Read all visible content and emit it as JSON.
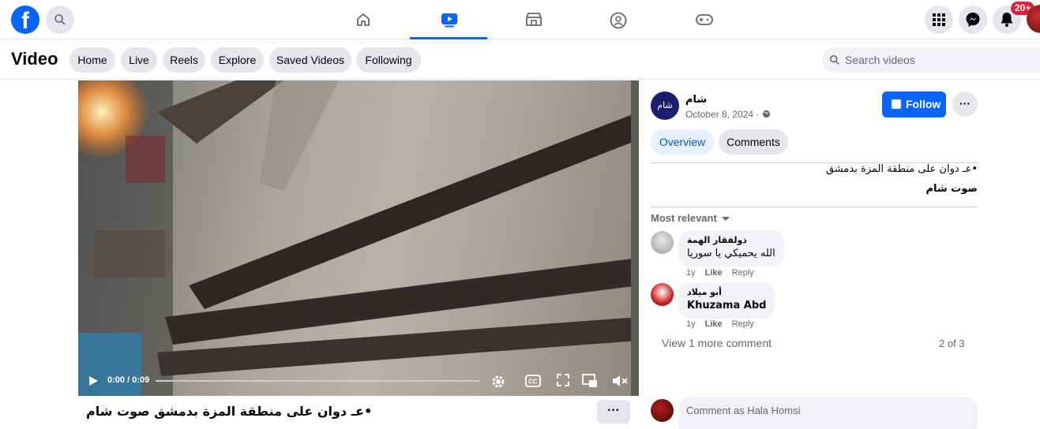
{
  "topnav": {
    "logo": "f",
    "notifications_badge": "20+",
    "tabs": [
      {
        "name": "home-icon",
        "active": false
      },
      {
        "name": "video-icon",
        "active": true
      },
      {
        "name": "marketplace-icon",
        "active": false
      },
      {
        "name": "groups-icon",
        "active": false
      },
      {
        "name": "gaming-icon",
        "active": false
      }
    ],
    "accent": "#0866ff"
  },
  "header": {
    "title": "Video",
    "pills": [
      "Home",
      "Live",
      "Reels",
      "Explore",
      "Saved Videos",
      "Following"
    ],
    "search_placeholder": "Search videos"
  },
  "video": {
    "time": "0:00 / 0:09",
    "caption": "•عـ دوان على منطقة المزة بدمشق صوت شام",
    "more_label": "···"
  },
  "post": {
    "page_name": "شام",
    "avatar_text": "شام",
    "date": "October 8, 2024 · ",
    "follow_label": "Follow",
    "more_label": "···",
    "tabs": [
      "Overview",
      "Comments"
    ],
    "description_line1": "•عـ دوان على منطقة المزة بدمشق",
    "description_line2": "صوت شام"
  },
  "comments": {
    "sort_label": "Most relevant",
    "items": [
      {
        "author": "ذولفقار الهمة",
        "text": "الله يحميكي يا سوريا",
        "age": "1y",
        "like": "Like",
        "reply": "Reply"
      },
      {
        "author": "أبو ميلاد",
        "text": "Khuzama Abd",
        "age": "1y",
        "like": "Like",
        "reply": "Reply"
      }
    ],
    "view_more": "View 1 more comment",
    "page_count": "2 of 3",
    "input_placeholder": "Comment as Hala Homsi"
  }
}
